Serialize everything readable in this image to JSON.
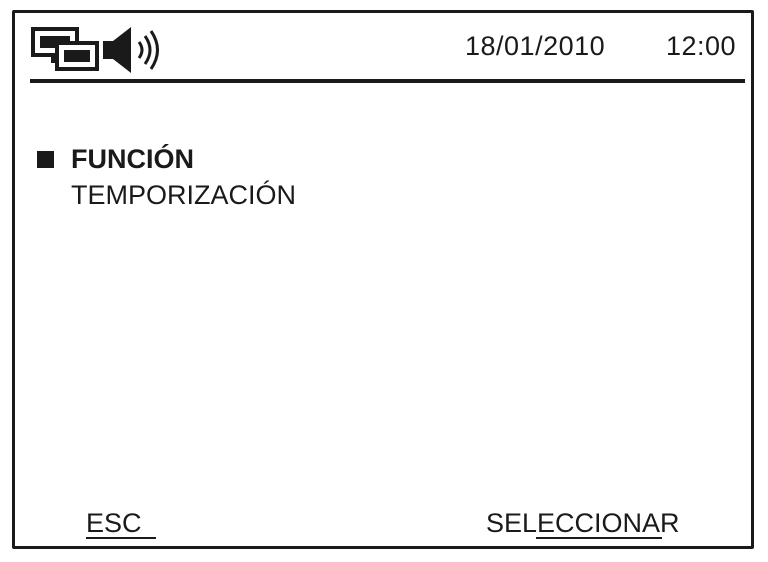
{
  "status_bar": {
    "date": "18/01/2010",
    "time": "12:00",
    "icons": [
      "network-icon",
      "speaker-icon"
    ]
  },
  "menu": {
    "items": [
      {
        "label": "FUNCIÓN",
        "selected": true
      },
      {
        "label": "TEMPORIZACIÓN",
        "selected": false
      }
    ]
  },
  "softkeys": {
    "left_label": "ESC",
    "right_label": "SELECCIONAR"
  },
  "colors": {
    "foreground": "#1a1a1a",
    "background": "#ffffff"
  }
}
